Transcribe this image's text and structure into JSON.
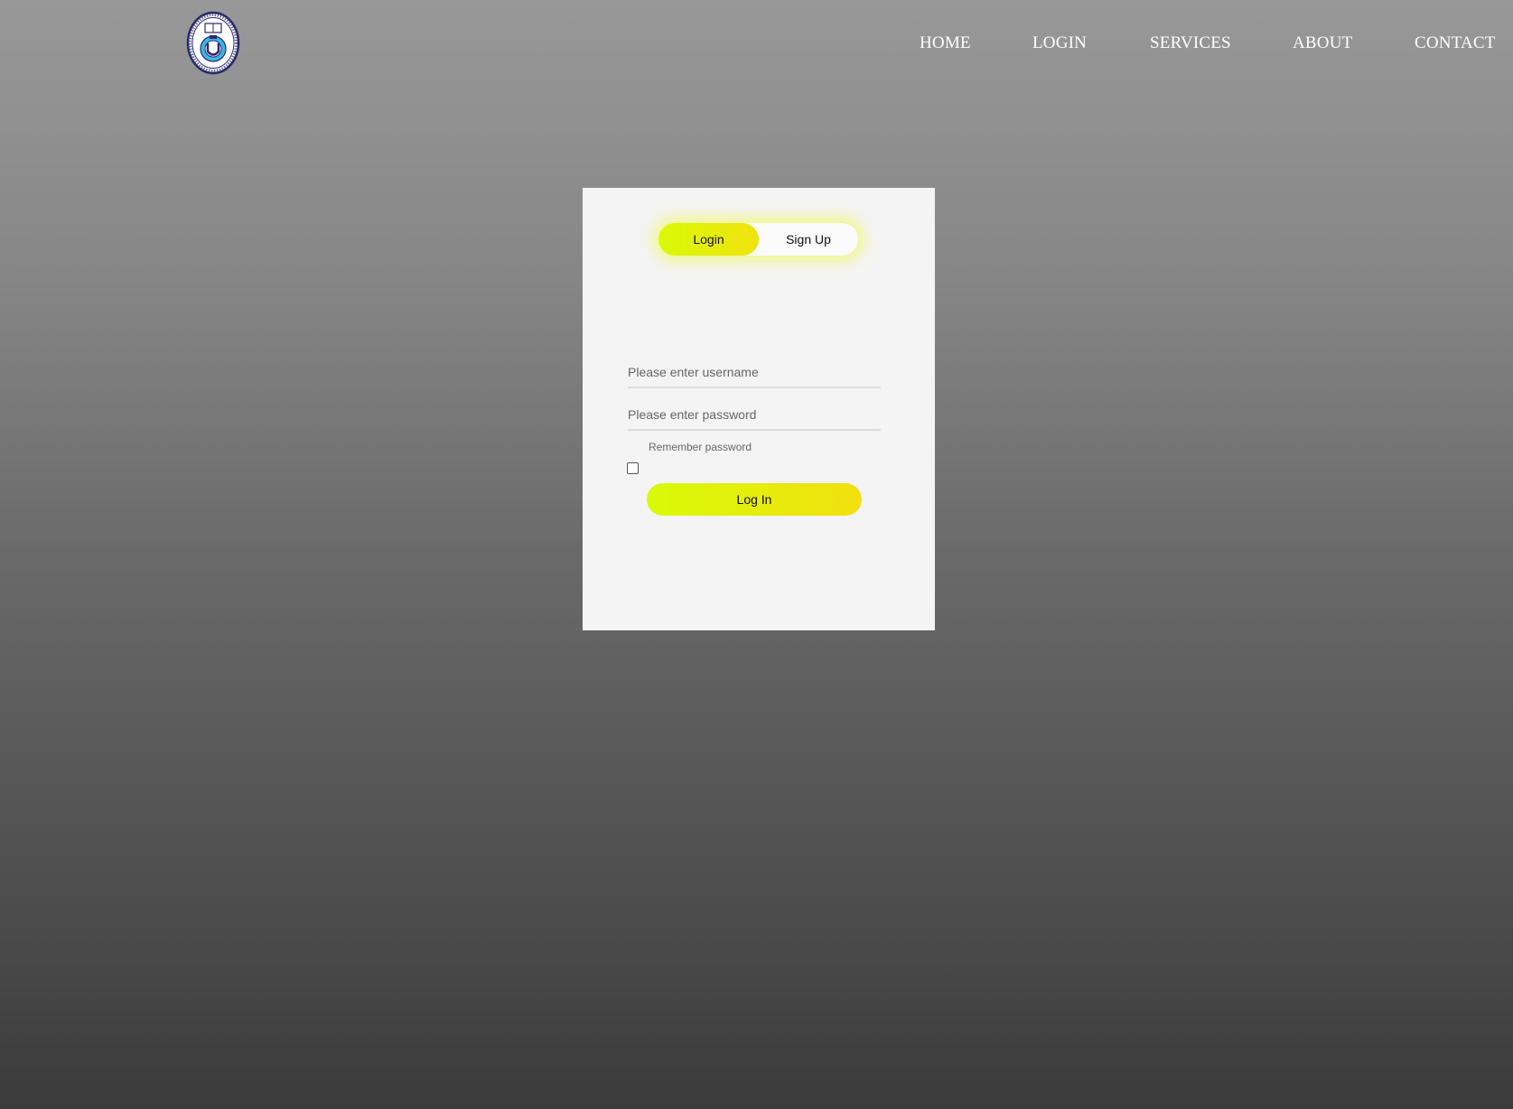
{
  "nav": {
    "items": [
      {
        "label": "HOME"
      },
      {
        "label": "LOGIN"
      },
      {
        "label": "SERVICES"
      },
      {
        "label": "ABOUT"
      },
      {
        "label": "CONTACT"
      }
    ]
  },
  "logo": {
    "icon": "university-seal-icon"
  },
  "auth": {
    "switch": {
      "login_label": "Login",
      "signup_label": "Sign Up",
      "active": "Login"
    },
    "username_placeholder": "Please enter username",
    "password_placeholder": "Please enter password",
    "remember_label": "Remember password",
    "remember_checked": false,
    "submit_label": "Log In"
  },
  "colors": {
    "accent_start": "#d8fa07",
    "accent_end": "#f2e00f",
    "card_bg": "#f4f4f4"
  }
}
